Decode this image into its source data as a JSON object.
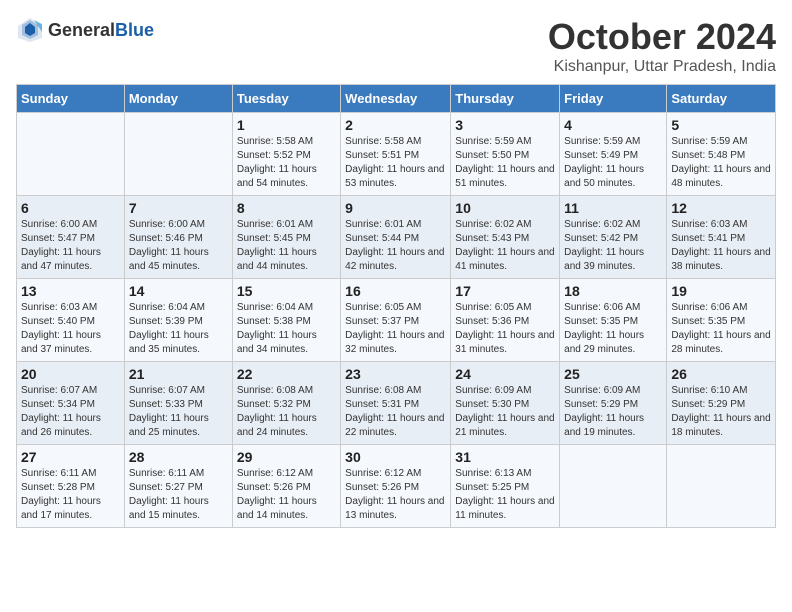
{
  "header": {
    "logo_general": "General",
    "logo_blue": "Blue",
    "month": "October 2024",
    "location": "Kishanpur, Uttar Pradesh, India"
  },
  "days_of_week": [
    "Sunday",
    "Monday",
    "Tuesday",
    "Wednesday",
    "Thursday",
    "Friday",
    "Saturday"
  ],
  "weeks": [
    [
      {
        "day": "",
        "sunrise": "",
        "sunset": "",
        "daylight": ""
      },
      {
        "day": "",
        "sunrise": "",
        "sunset": "",
        "daylight": ""
      },
      {
        "day": "1",
        "sunrise": "Sunrise: 5:58 AM",
        "sunset": "Sunset: 5:52 PM",
        "daylight": "Daylight: 11 hours and 54 minutes."
      },
      {
        "day": "2",
        "sunrise": "Sunrise: 5:58 AM",
        "sunset": "Sunset: 5:51 PM",
        "daylight": "Daylight: 11 hours and 53 minutes."
      },
      {
        "day": "3",
        "sunrise": "Sunrise: 5:59 AM",
        "sunset": "Sunset: 5:50 PM",
        "daylight": "Daylight: 11 hours and 51 minutes."
      },
      {
        "day": "4",
        "sunrise": "Sunrise: 5:59 AM",
        "sunset": "Sunset: 5:49 PM",
        "daylight": "Daylight: 11 hours and 50 minutes."
      },
      {
        "day": "5",
        "sunrise": "Sunrise: 5:59 AM",
        "sunset": "Sunset: 5:48 PM",
        "daylight": "Daylight: 11 hours and 48 minutes."
      }
    ],
    [
      {
        "day": "6",
        "sunrise": "Sunrise: 6:00 AM",
        "sunset": "Sunset: 5:47 PM",
        "daylight": "Daylight: 11 hours and 47 minutes."
      },
      {
        "day": "7",
        "sunrise": "Sunrise: 6:00 AM",
        "sunset": "Sunset: 5:46 PM",
        "daylight": "Daylight: 11 hours and 45 minutes."
      },
      {
        "day": "8",
        "sunrise": "Sunrise: 6:01 AM",
        "sunset": "Sunset: 5:45 PM",
        "daylight": "Daylight: 11 hours and 44 minutes."
      },
      {
        "day": "9",
        "sunrise": "Sunrise: 6:01 AM",
        "sunset": "Sunset: 5:44 PM",
        "daylight": "Daylight: 11 hours and 42 minutes."
      },
      {
        "day": "10",
        "sunrise": "Sunrise: 6:02 AM",
        "sunset": "Sunset: 5:43 PM",
        "daylight": "Daylight: 11 hours and 41 minutes."
      },
      {
        "day": "11",
        "sunrise": "Sunrise: 6:02 AM",
        "sunset": "Sunset: 5:42 PM",
        "daylight": "Daylight: 11 hours and 39 minutes."
      },
      {
        "day": "12",
        "sunrise": "Sunrise: 6:03 AM",
        "sunset": "Sunset: 5:41 PM",
        "daylight": "Daylight: 11 hours and 38 minutes."
      }
    ],
    [
      {
        "day": "13",
        "sunrise": "Sunrise: 6:03 AM",
        "sunset": "Sunset: 5:40 PM",
        "daylight": "Daylight: 11 hours and 37 minutes."
      },
      {
        "day": "14",
        "sunrise": "Sunrise: 6:04 AM",
        "sunset": "Sunset: 5:39 PM",
        "daylight": "Daylight: 11 hours and 35 minutes."
      },
      {
        "day": "15",
        "sunrise": "Sunrise: 6:04 AM",
        "sunset": "Sunset: 5:38 PM",
        "daylight": "Daylight: 11 hours and 34 minutes."
      },
      {
        "day": "16",
        "sunrise": "Sunrise: 6:05 AM",
        "sunset": "Sunset: 5:37 PM",
        "daylight": "Daylight: 11 hours and 32 minutes."
      },
      {
        "day": "17",
        "sunrise": "Sunrise: 6:05 AM",
        "sunset": "Sunset: 5:36 PM",
        "daylight": "Daylight: 11 hours and 31 minutes."
      },
      {
        "day": "18",
        "sunrise": "Sunrise: 6:06 AM",
        "sunset": "Sunset: 5:35 PM",
        "daylight": "Daylight: 11 hours and 29 minutes."
      },
      {
        "day": "19",
        "sunrise": "Sunrise: 6:06 AM",
        "sunset": "Sunset: 5:35 PM",
        "daylight": "Daylight: 11 hours and 28 minutes."
      }
    ],
    [
      {
        "day": "20",
        "sunrise": "Sunrise: 6:07 AM",
        "sunset": "Sunset: 5:34 PM",
        "daylight": "Daylight: 11 hours and 26 minutes."
      },
      {
        "day": "21",
        "sunrise": "Sunrise: 6:07 AM",
        "sunset": "Sunset: 5:33 PM",
        "daylight": "Daylight: 11 hours and 25 minutes."
      },
      {
        "day": "22",
        "sunrise": "Sunrise: 6:08 AM",
        "sunset": "Sunset: 5:32 PM",
        "daylight": "Daylight: 11 hours and 24 minutes."
      },
      {
        "day": "23",
        "sunrise": "Sunrise: 6:08 AM",
        "sunset": "Sunset: 5:31 PM",
        "daylight": "Daylight: 11 hours and 22 minutes."
      },
      {
        "day": "24",
        "sunrise": "Sunrise: 6:09 AM",
        "sunset": "Sunset: 5:30 PM",
        "daylight": "Daylight: 11 hours and 21 minutes."
      },
      {
        "day": "25",
        "sunrise": "Sunrise: 6:09 AM",
        "sunset": "Sunset: 5:29 PM",
        "daylight": "Daylight: 11 hours and 19 minutes."
      },
      {
        "day": "26",
        "sunrise": "Sunrise: 6:10 AM",
        "sunset": "Sunset: 5:29 PM",
        "daylight": "Daylight: 11 hours and 18 minutes."
      }
    ],
    [
      {
        "day": "27",
        "sunrise": "Sunrise: 6:11 AM",
        "sunset": "Sunset: 5:28 PM",
        "daylight": "Daylight: 11 hours and 17 minutes."
      },
      {
        "day": "28",
        "sunrise": "Sunrise: 6:11 AM",
        "sunset": "Sunset: 5:27 PM",
        "daylight": "Daylight: 11 hours and 15 minutes."
      },
      {
        "day": "29",
        "sunrise": "Sunrise: 6:12 AM",
        "sunset": "Sunset: 5:26 PM",
        "daylight": "Daylight: 11 hours and 14 minutes."
      },
      {
        "day": "30",
        "sunrise": "Sunrise: 6:12 AM",
        "sunset": "Sunset: 5:26 PM",
        "daylight": "Daylight: 11 hours and 13 minutes."
      },
      {
        "day": "31",
        "sunrise": "Sunrise: 6:13 AM",
        "sunset": "Sunset: 5:25 PM",
        "daylight": "Daylight: 11 hours and 11 minutes."
      },
      {
        "day": "",
        "sunrise": "",
        "sunset": "",
        "daylight": ""
      },
      {
        "day": "",
        "sunrise": "",
        "sunset": "",
        "daylight": ""
      }
    ]
  ]
}
